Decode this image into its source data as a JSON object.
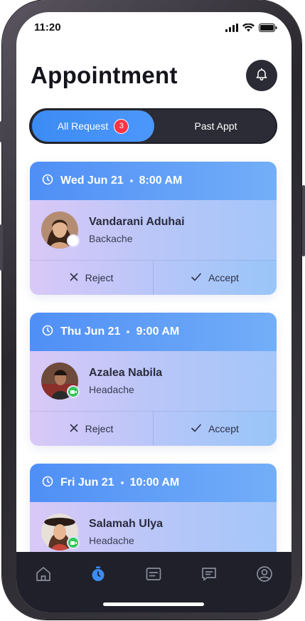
{
  "status": {
    "time": "11:20"
  },
  "header": {
    "title": "Appointment"
  },
  "tabs": {
    "active_label": "All Request",
    "badge_count": "3",
    "inactive_label": "Past Appt"
  },
  "appointments": [
    {
      "date": "Wed Jun 21",
      "time": "8:00 AM",
      "name": "Vandarani Aduhai",
      "complaint": "Backache",
      "status_color": "#ffffff"
    },
    {
      "date": "Thu Jun 21",
      "time": "9:00 AM",
      "name": "Azalea Nabila",
      "complaint": "Headache",
      "status_color": "#34c759"
    },
    {
      "date": "Fri Jun 21",
      "time": "10:00 AM",
      "name": "Salamah Ulya",
      "complaint": "Headache",
      "status_color": "#34c759"
    }
  ],
  "actions": {
    "reject_label": "Reject",
    "accept_label": "Accept"
  },
  "nav": {
    "items": [
      {
        "icon": "home-icon",
        "active": false
      },
      {
        "icon": "timer-icon",
        "active": true
      },
      {
        "icon": "document-icon",
        "active": false
      },
      {
        "icon": "chat-icon",
        "active": false
      },
      {
        "icon": "profile-icon",
        "active": false
      }
    ]
  },
  "colors": {
    "accent": "#3c8bf4",
    "badge": "#ff3344",
    "dark": "#1f2029"
  }
}
